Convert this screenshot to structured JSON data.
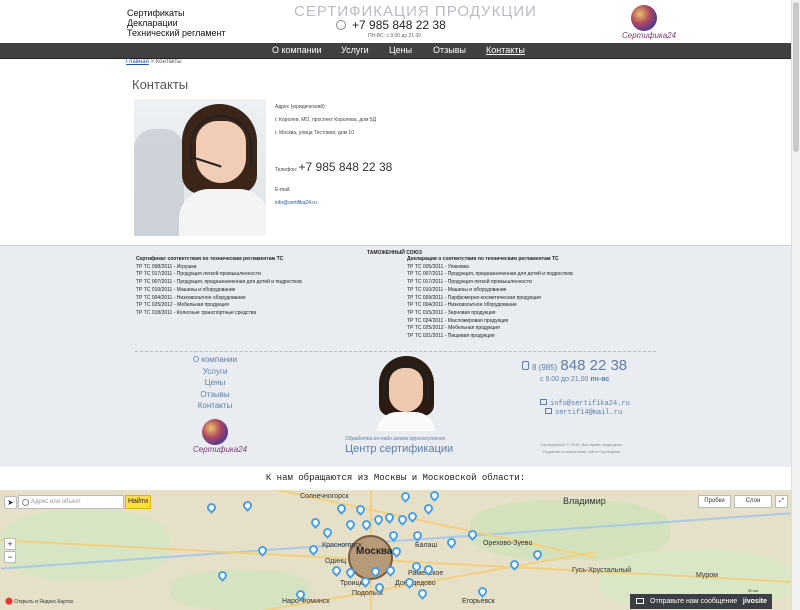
{
  "header": {
    "doc_links": [
      "Сертификаты",
      "Декларации",
      "Технический регламент"
    ],
    "site_title": "СЕРТИФИКАЦИЯ ПРОДУКЦИИ",
    "phone": "+7 985 848 22 38",
    "hours": "ПН-ВС: с 9.00 до 21.00",
    "logo_text": "Сертифика24"
  },
  "nav": {
    "items": [
      "О компании",
      "Услуги",
      "Цены",
      "Отзывы",
      "Контакты"
    ],
    "active": "Контакты"
  },
  "breadcrumb": {
    "home": "Главная",
    "separator": " > ",
    "current": "Контакты"
  },
  "page_title": "Контакты",
  "contacts": {
    "address_label": "Адрес (юридический):",
    "address1": "г. Королев, МО, проспект Королева, дом 5Д",
    "address2": "г. Москва, улица Тестовая, дом 10",
    "phone_label": "Телефон:",
    "phone": "+7 985 848 22 38",
    "email_label": "E-mail:",
    "email": "info@sertifika24.ru"
  },
  "footer": {
    "union_title": "ТАМОЖЕННЫЙ СОЮЗ",
    "left_col": {
      "head": "Сертификат соответствия по техническим регламентам ТС",
      "items": [
        "ТР ТС 008/2011 - Игрушки",
        "ТР ТС 017/2011 - Продукция легкой промышленности",
        "ТР ТС 007/2011 - Продукция, предназначенная для детей и подростков",
        "ТР ТС 010/2011 - Машины и оборудование",
        "ТР ТС 004/2011 - Низковольтное оборудование",
        "ТР ТС 025/2012 - Мебельная продукция",
        "ТР ТС 018/2011 - Колесные транспортные средства"
      ]
    },
    "right_col": {
      "head": "Декларация о соответствии по техническим регламентам ТС",
      "items": [
        "ТР ТС 005/2011 - Упаковка",
        "ТР ТС 007/2011 - Продукция, предназначенная для детей и подростков",
        "ТР ТС 017/2011 - Продукция легкой промышленности",
        "ТР ТС 010/2011 - Машины и оборудование",
        "ТР ТС 009/2011 - Парфюмерно-косметическая продукция",
        "ТР ТС 004/2011 - Низковольтное оборудование",
        "ТР ТС 015/2011 - Зерновая продукция",
        "ТР ТС 024/2011 - Масложировая продукция",
        "ТР ТС 025/2012 - Мебельная продукция",
        "ТР ТС 021/2011 - Пищевая продукция"
      ]
    },
    "nav": [
      "О компании",
      "Услуги",
      "Цены",
      "Отзывы",
      "Контакты"
    ],
    "logo_text": "Сертифика24",
    "tagline": "Обработка он-лайн заявок круглосуточно",
    "center_title": "Центр сертификации",
    "phone_prefix": "8 (985)",
    "phone_main": "848 22 38",
    "hours_prefix": "с 9.00 до 21.00",
    "hours_days": "пн-вс",
    "email1": "info@sertifika24.ru",
    "email2": "sertif14@mail.ru",
    "copyright1": "Сертифика24 © 2016. Все права защищены",
    "copyright2": "Создание и наполнение сайта Сертифика"
  },
  "clients_heading": "К нам обращаются из Москвы и Московской области:",
  "map": {
    "search_placeholder": "Адрес или объект",
    "find_button": "Найти",
    "traffic_button": "Пробки",
    "layers_button": "Слои",
    "fullscreen_button": "",
    "open_in_yandex": "Открыть в Яндекс.Картах",
    "scale": "30 км",
    "labels": {
      "solnechnogorsk": "Солнечногорск",
      "moscow": "Москва",
      "vladimir": "Владимир",
      "orekhovo": "Орехово-Зуево",
      "gus": "Гусь-Хрустальный",
      "murom": "Муром",
      "naro": "Наро-Фоминск",
      "podolsk": "Подольск",
      "domodedovo": "Домодедово",
      "egorievsk": "Егорьевск",
      "odintsovo": "Одинц",
      "troitsk": "Троицк",
      "balashikha": "Балаш",
      "kolomenskoe": "Раменское",
      "krasnogorsk": "Красногорск"
    }
  },
  "chat": {
    "label": "Отправьте нам сообщение",
    "brand": "jivosite"
  }
}
